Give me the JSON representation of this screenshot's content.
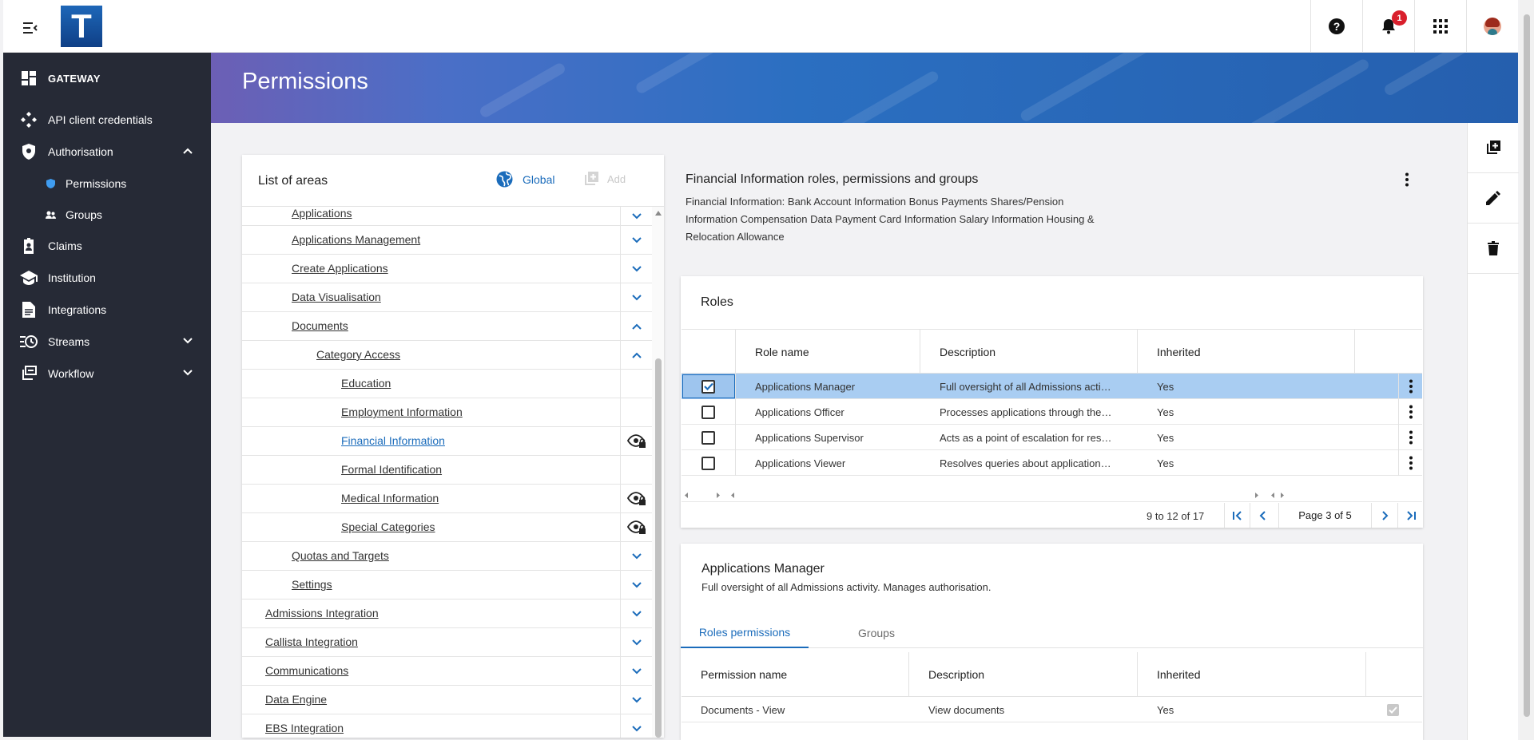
{
  "app": {
    "logo_letter": "T",
    "notification_count": "1"
  },
  "colors": {
    "sidebar_bg": "#262a36",
    "accent": "#1b6cbb",
    "selected_row": "#a9cdf2",
    "badge": "#d91f2c"
  },
  "sidebar": {
    "header": "GATEWAY",
    "items": [
      {
        "label": "API client credentials",
        "icon": "api-icon"
      },
      {
        "label": "Authorisation",
        "icon": "shield-icon",
        "expanded": true
      },
      {
        "label": "Permissions",
        "icon": "shield-small-icon",
        "sub": true
      },
      {
        "label": "Groups",
        "icon": "groups-icon",
        "sub": true
      },
      {
        "label": "Claims",
        "icon": "badge-icon"
      },
      {
        "label": "Institution",
        "icon": "school-icon"
      },
      {
        "label": "Integrations",
        "icon": "document-icon"
      },
      {
        "label": "Streams",
        "icon": "streams-icon",
        "expandable": true
      },
      {
        "label": "Workflow",
        "icon": "workflow-icon",
        "expandable": true
      }
    ]
  },
  "banner": {
    "title": "Permissions"
  },
  "left_panel": {
    "title": "List of areas",
    "global_label": "Global",
    "add_label": "Add",
    "tree": [
      {
        "label": "Applications",
        "action": "chevron-down"
      },
      {
        "label": "Applications Management",
        "action": "chevron-down"
      },
      {
        "label": "Create Applications",
        "action": "chevron-down"
      },
      {
        "label": "Data Visualisation",
        "action": "chevron-down"
      },
      {
        "label": "Documents",
        "action": "chevron-up"
      },
      {
        "label": "Category Access",
        "action": "chevron-up"
      },
      {
        "label": "Education",
        "action": "none"
      },
      {
        "label": "Employment Information",
        "action": "none"
      },
      {
        "label": "Financial Information",
        "action": "eye-lock",
        "active": true
      },
      {
        "label": "Formal Identification",
        "action": "none"
      },
      {
        "label": "Medical Information",
        "action": "eye-lock"
      },
      {
        "label": "Special Categories",
        "action": "eye-lock"
      },
      {
        "label": "Quotas and Targets",
        "action": "chevron-down"
      },
      {
        "label": "Settings",
        "action": "chevron-down"
      },
      {
        "label": "Admissions Integration",
        "action": "chevron-down"
      },
      {
        "label": "Callista Integration",
        "action": "chevron-down"
      },
      {
        "label": "Communications",
        "action": "chevron-down"
      },
      {
        "label": "Data Engine",
        "action": "chevron-down"
      },
      {
        "label": "EBS Integration",
        "action": "chevron-down"
      }
    ]
  },
  "details": {
    "title": "Financial Information roles, permissions and groups",
    "description": "Financial Information: Bank Account Information Bonus Payments Shares/Pension Information Compensation Data Payment Card Information Salary Information Housing & Relocation Allowance"
  },
  "roles": {
    "title": "Roles",
    "columns": [
      "Role name",
      "Description",
      "Inherited"
    ],
    "rows": [
      {
        "name": "Applications Manager",
        "description": "Full oversight of all Admissions acti…",
        "inherited": "Yes",
        "checked": true
      },
      {
        "name": "Applications Officer",
        "description": "Processes applications through the…",
        "inherited": "Yes",
        "checked": false
      },
      {
        "name": "Applications Supervisor",
        "description": "Acts as a point of escalation for res…",
        "inherited": "Yes",
        "checked": false
      },
      {
        "name": "Applications Viewer",
        "description": "Resolves queries about application…",
        "inherited": "Yes",
        "checked": false
      }
    ],
    "pager": {
      "range": "9 to 12 of 17",
      "page": "Page 3 of 5"
    }
  },
  "selected_role": {
    "title": "Applications Manager",
    "description": "Full oversight of all Admissions activity. Manages authorisation.",
    "tabs": [
      "Roles permissions",
      "Groups"
    ],
    "columns": [
      "Permission name",
      "Description",
      "Inherited"
    ],
    "rows": [
      {
        "name": "Documents - View",
        "description": "View documents",
        "inherited": "Yes"
      }
    ]
  }
}
